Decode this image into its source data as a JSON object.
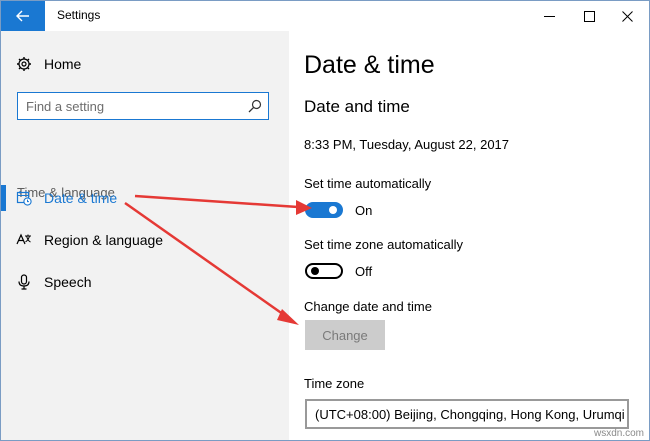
{
  "window": {
    "title": "Settings"
  },
  "sidebar": {
    "home_label": "Home",
    "search_placeholder": "Find a setting",
    "section_label": "Time & language",
    "items": [
      {
        "label": "Date & time",
        "icon": "calendar-clock-icon",
        "active": true
      },
      {
        "label": "Region & language",
        "icon": "language-icon",
        "active": false
      },
      {
        "label": "Speech",
        "icon": "microphone-icon",
        "active": false
      }
    ]
  },
  "main": {
    "page_title": "Date & time",
    "subheading": "Date and time",
    "current_datetime": "8:33 PM, Tuesday, August 22, 2017",
    "set_time_auto": {
      "label": "Set time automatically",
      "state": "On"
    },
    "set_timezone_auto": {
      "label": "Set time zone automatically",
      "state": "Off"
    },
    "change_datetime": {
      "label": "Change date and time",
      "button": "Change"
    },
    "time_zone": {
      "label": "Time zone",
      "value": "(UTC+08:00) Beijing, Chongqing, Hong Kong, Urumqi"
    }
  },
  "watermark": "wsxdn.com",
  "colors": {
    "accent": "#1a78d2",
    "arrow": "#e53935",
    "sidebar_bg": "#f2f2f2"
  }
}
